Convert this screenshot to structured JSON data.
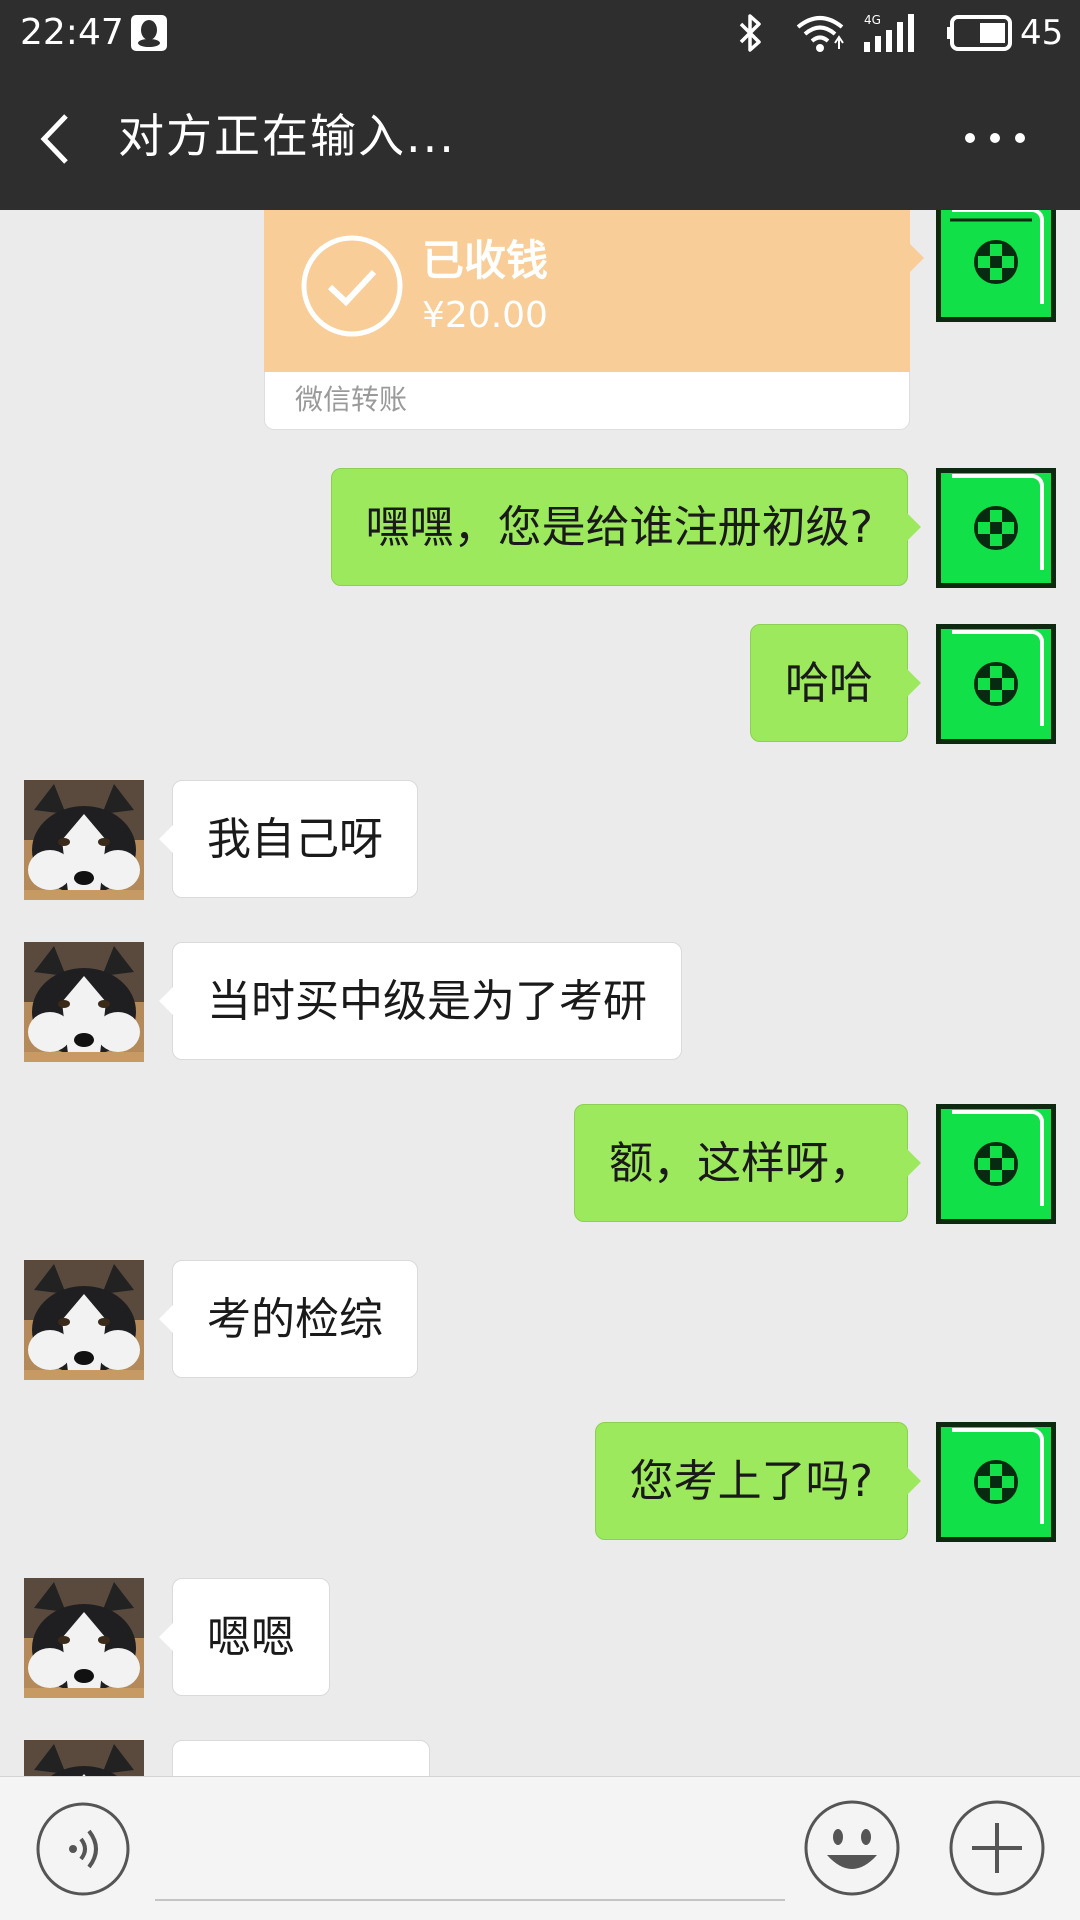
{
  "status_bar": {
    "time": "22:47",
    "battery_level": "45",
    "network": "4G"
  },
  "header": {
    "title": "对方正在输入..."
  },
  "transfer": {
    "status": "已收钱",
    "amount": "¥20.00",
    "source": "微信转账"
  },
  "messages": [
    {
      "side": "right",
      "text": "嘿嘿，您是给谁注册初级?"
    },
    {
      "side": "right",
      "text": "哈哈"
    },
    {
      "side": "left",
      "text": "我自己呀"
    },
    {
      "side": "left",
      "text": "当时买中级是为了考研"
    },
    {
      "side": "right",
      "text": "额，这样呀，"
    },
    {
      "side": "left",
      "text": "考的检综"
    },
    {
      "side": "right",
      "text": "您考上了吗?"
    },
    {
      "side": "left",
      "text": "嗯嗯"
    },
    {
      "side": "left",
      "text": ""
    }
  ],
  "input": {
    "value": ""
  },
  "colors": {
    "header_bg": "#2e2e2e",
    "chat_bg": "#ebebeb",
    "bubble_green": "#9de95e",
    "bubble_white": "#ffffff",
    "transfer_orange": "#f9cd97",
    "avatar_green": "#11e049"
  }
}
